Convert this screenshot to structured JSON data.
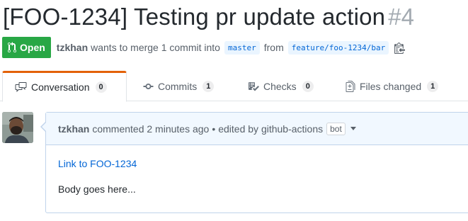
{
  "pr": {
    "title": "[FOO-1234] Testing pr update action",
    "number": "#4",
    "state": "Open",
    "author": "tzkhan",
    "merge_text_1": "wants to merge 1 commit into",
    "base_branch": "master",
    "merge_text_2": "from",
    "head_branch": "feature/foo-1234/bar"
  },
  "tabs": [
    {
      "label": "Conversation",
      "count": "0",
      "icon": "comment-discussion-icon"
    },
    {
      "label": "Commits",
      "count": "1",
      "icon": "git-commit-icon"
    },
    {
      "label": "Checks",
      "count": "0",
      "icon": "checklist-icon"
    },
    {
      "label": "Files changed",
      "count": "1",
      "icon": "file-diff-icon"
    }
  ],
  "comment": {
    "author": "tzkhan",
    "action": "commented 2 minutes ago",
    "separator": "•",
    "edited": "edited by github-actions",
    "bot_label": "bot",
    "link_text": "Link to FOO-1234",
    "body_text": "Body goes here..."
  },
  "colors": {
    "open_green": "#28a745",
    "link_blue": "#0366d6",
    "tab_accent": "#e36209"
  }
}
